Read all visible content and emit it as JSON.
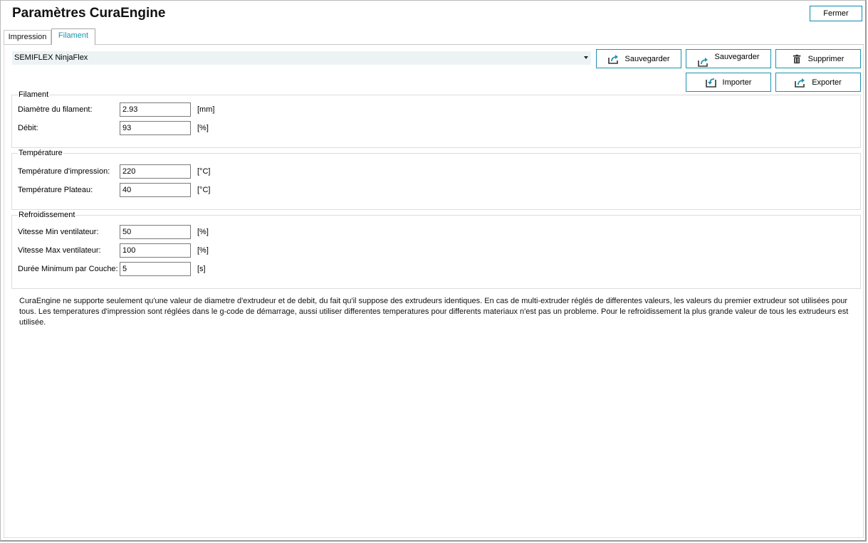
{
  "window": {
    "title": "Paramètres CuraEngine",
    "close_label": "Fermer"
  },
  "tabs": [
    {
      "label": "Impression",
      "active": false
    },
    {
      "label": "Filament",
      "active": true
    }
  ],
  "profile": {
    "selected": "SEMIFLEX NinjaFlex"
  },
  "actions": {
    "save1": {
      "label": "Sauvegarder",
      "icon": "share-arrow-icon"
    },
    "save2": {
      "label": "Sauvegarder",
      "icon": "share-arrow-icon"
    },
    "delete": {
      "label": "Supprimer",
      "icon": "trash-icon"
    },
    "import": {
      "label": "Importer",
      "icon": "import-icon"
    },
    "export": {
      "label": "Exporter",
      "icon": "export-icon"
    }
  },
  "groups": {
    "filament": {
      "title": "Filament",
      "fields": [
        {
          "label": "Diamètre du filament:",
          "value": "2.93",
          "unit": "[mm]"
        },
        {
          "label": "Débit:",
          "value": "93",
          "unit": "[%]"
        }
      ]
    },
    "temperature": {
      "title": "Température",
      "fields": [
        {
          "label": "Température d'impression:",
          "value": "220",
          "unit": "[°C]"
        },
        {
          "label": "Température Plateau:",
          "value": "40",
          "unit": "[°C]"
        }
      ]
    },
    "cooling": {
      "title": "Refroidissement",
      "fields": [
        {
          "label": "Vitesse Min ventilateur:",
          "value": "50",
          "unit": "[%]"
        },
        {
          "label": "Vitesse Max ventilateur:",
          "value": "100",
          "unit": "[%]"
        },
        {
          "label": "Durée Minimum par Couche:",
          "value": "5",
          "unit": "[s]"
        }
      ]
    }
  },
  "info_text": "CuraEngine ne supporte seulement qu'une valeur de diametre d'extrudeur et de debit, du fait qu'il suppose des extrudeurs identiques. En cas de multi-extruder réglés de differentes valeurs, les valeurs du premier extrudeur sot utilisées pour tous. Les temperatures d'impression sont réglées dans le g-code de démarrage, aussi utiliser differentes temperatures pour differents materiaux n'est pas un probleme. Pour le refroidissement la plus grande valeur de tous les extrudeurs est utilisée.",
  "colors": {
    "accent": "#1b93ad",
    "select_bg": "#edf3f5",
    "text": "#000000"
  }
}
